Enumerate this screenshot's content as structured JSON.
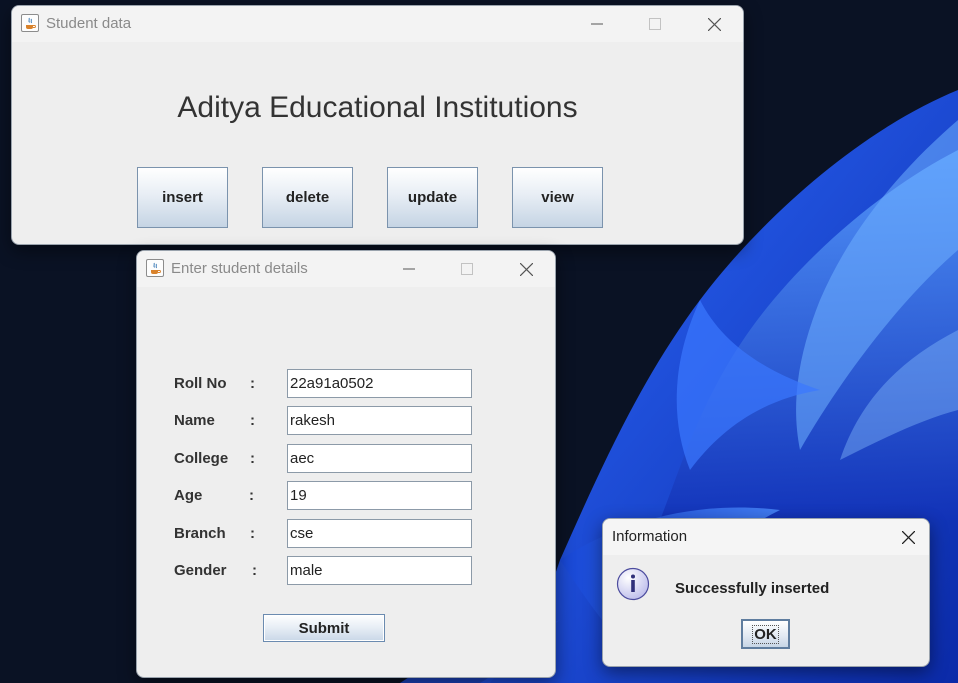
{
  "main_window": {
    "title": "Student data",
    "heading": "Aditya Educational Institutions",
    "buttons": [
      "insert",
      "delete",
      "update",
      "view"
    ]
  },
  "details_window": {
    "title": "Enter student details",
    "fields": [
      {
        "label": "Roll No",
        "colon": ":",
        "value": "22a91a0502"
      },
      {
        "label": "Name",
        "colon": ":",
        "value": "rakesh"
      },
      {
        "label": "College",
        "colon": ":",
        "value": "aec"
      },
      {
        "label": "Age",
        "colon": ":",
        "value": "19"
      },
      {
        "label": "Branch",
        "colon": ":",
        "value": "cse"
      },
      {
        "label": "Gender",
        "colon": ":",
        "value": "male"
      }
    ],
    "submit_label": "Submit"
  },
  "info_dialog": {
    "title": "Information",
    "message": "Successfully inserted",
    "ok_label": "OK"
  },
  "colors": {
    "window_bg": "#eeeeee",
    "desktop_bg": "#0a1224",
    "wallpaper_accent": "#1f4fe0"
  }
}
